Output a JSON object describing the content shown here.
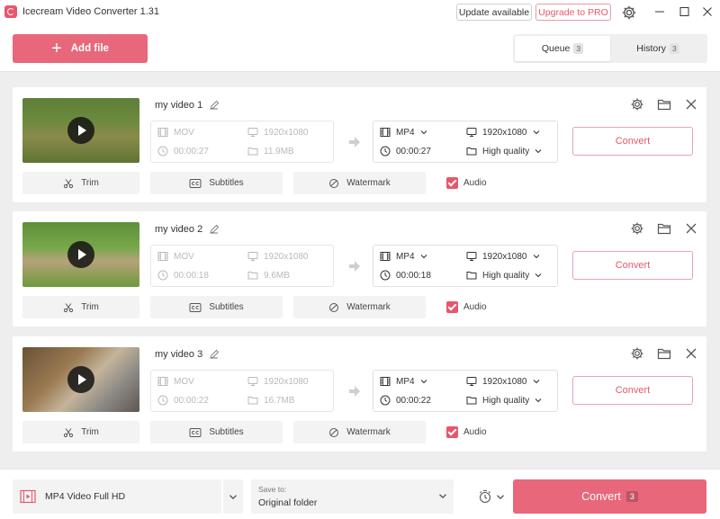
{
  "app": {
    "title": "Icecream Video Converter 1.31"
  },
  "titlebar": {
    "update_label": "Update available",
    "pro_label": "Upgrade to PRO"
  },
  "header": {
    "add_file_label": "Add file",
    "tabs": [
      {
        "label": "Queue",
        "count": "3",
        "active": true
      },
      {
        "label": "History",
        "count": "3",
        "active": false
      }
    ]
  },
  "videos": [
    {
      "name": "my video 1",
      "src_format": "MOV",
      "src_resolution": "1920x1080",
      "src_duration": "00:00:27",
      "src_size": "11.9MB",
      "out_format": "MP4",
      "out_resolution": "1920x1080",
      "out_duration": "00:00:27",
      "out_quality": "High quality"
    },
    {
      "name": "my video 2",
      "src_format": "MOV",
      "src_resolution": "1920x1080",
      "src_duration": "00:00:18",
      "src_size": "9.6MB",
      "out_format": "MP4",
      "out_resolution": "1920x1080",
      "out_duration": "00:00:18",
      "out_quality": "High quality"
    },
    {
      "name": "my video 3",
      "src_format": "MOV",
      "src_resolution": "1920x1080",
      "src_duration": "00:00:22",
      "src_size": "16.7MB",
      "out_format": "MP4",
      "out_resolution": "1920x1080",
      "out_duration": "00:00:22",
      "out_quality": "High quality"
    }
  ],
  "card_labels": {
    "convert": "Convert",
    "trim": "Trim",
    "subtitles": "Subtitles",
    "watermark": "Watermark",
    "audio": "Audio",
    "audio_checked": true
  },
  "bottom": {
    "preset": "MP4 Video Full HD",
    "save_to_label": "Save to:",
    "save_to_value": "Original folder",
    "convert_label": "Convert",
    "convert_count": "3"
  },
  "colors": {
    "accent": "#e8677a",
    "accent_text": "#e8566b",
    "panel": "#f3f3f3"
  },
  "icons": [
    "app-logo",
    "settings-icon",
    "minimize-icon",
    "maximize-icon",
    "close-icon",
    "plus-icon",
    "play-icon",
    "edit-icon",
    "film-icon",
    "monitor-icon",
    "clock-icon",
    "folder-icon",
    "arrow-right-icon",
    "chevron-down-icon",
    "scissors-icon",
    "cc-icon",
    "watermark-icon",
    "checkbox-icon",
    "timer-icon"
  ]
}
